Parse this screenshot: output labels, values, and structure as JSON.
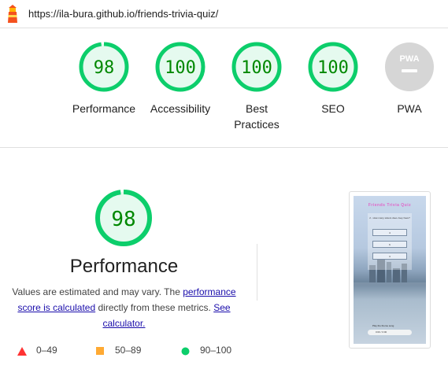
{
  "browser": {
    "url": "https://ila-bura.github.io/friends-trivia-quiz/",
    "icon": "lighthouse-icon"
  },
  "summary_gauges": [
    {
      "score": "98",
      "label": "Performance",
      "fraction": 0.98
    },
    {
      "score": "100",
      "label": "Accessibility",
      "fraction": 1.0
    },
    {
      "score": "100",
      "label": "Best",
      "label2": "Practices",
      "fraction": 1.0
    },
    {
      "score": "100",
      "label": "SEO",
      "fraction": 1.0
    },
    {
      "score": "PWA",
      "label": "PWA",
      "fraction": 0
    }
  ],
  "performance": {
    "score": "98",
    "fraction": 0.98,
    "title": "Performance",
    "desc_before": "Values are estimated and may vary. The ",
    "link_score": "performance score is calculated",
    "desc_middle": " directly from these metrics. ",
    "link_calc": "See calculator."
  },
  "legend": [
    {
      "range": "0–49",
      "shape": "triangle",
      "color": "#ff3333"
    },
    {
      "range": "50–89",
      "shape": "square",
      "color": "#ffaa33"
    },
    {
      "range": "90–100",
      "shape": "circle",
      "color": "#0cce6b"
    }
  ],
  "thumbnail": {
    "title": "Friends Trivia Quiz",
    "question": "2 - How many sisters does Joey have?",
    "answers": [
      "4",
      "6",
      "3"
    ],
    "footer": "Play the theme song",
    "player": "0:00 / 0:00"
  },
  "colors": {
    "pass": "#0cce6b",
    "pass_text": "#008800",
    "pass_fill": "#e5faef",
    "pwa_gray": "#d6d6d6"
  }
}
